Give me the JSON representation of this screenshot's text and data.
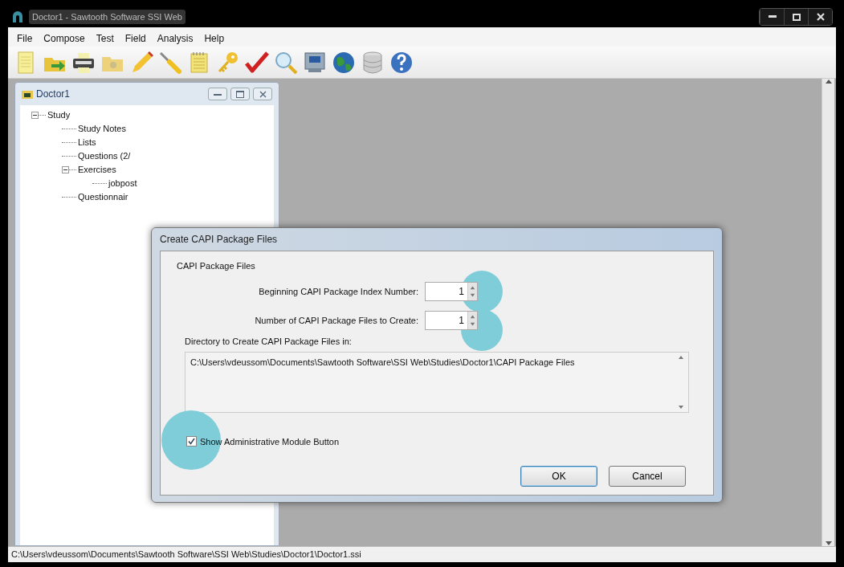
{
  "window": {
    "title": "Doctor1 - Sawtooth Software SSI Web"
  },
  "menu": [
    "File",
    "Compose",
    "Test",
    "Field",
    "Analysis",
    "Help"
  ],
  "child_window": {
    "title": "Doctor1",
    "tree": [
      {
        "label": "Study",
        "expanded": true,
        "children": [
          {
            "label": "Study Notes"
          },
          {
            "label": "Lists"
          },
          {
            "label": "Questions (2/"
          },
          {
            "label": "Exercises",
            "expanded": true,
            "children": [
              {
                "label": "jobpost"
              }
            ]
          },
          {
            "label": "Questionnair"
          }
        ]
      }
    ]
  },
  "dialog": {
    "title": "Create CAPI Package Files",
    "group_label": "CAPI Package Files",
    "fields": [
      {
        "label": "Beginning CAPI Package Index Number:",
        "value": "1",
        "highlighted": true
      },
      {
        "label": "Number of CAPI Package Files to Create:",
        "value": "1",
        "highlighted": true
      }
    ],
    "directory_label": "Directory to Create CAPI Package Files in:",
    "directory": "C:\\Users\\vdeussom\\Documents\\Sawtooth Software\\SSI Web\\Studies\\Doctor1\\CAPI Package Files",
    "checkbox": {
      "label": "Show Administrative Module Button",
      "checked": true,
      "highlighted": true
    },
    "buttons": [
      {
        "label": "OK",
        "default": true
      },
      {
        "label": "Cancel",
        "default": false
      }
    ]
  },
  "status_bar": "C:\\Users\\vdeussom\\Documents\\Sawtooth Software\\SSI Web\\Studies\\Doctor1\\Doctor1.ssi"
}
